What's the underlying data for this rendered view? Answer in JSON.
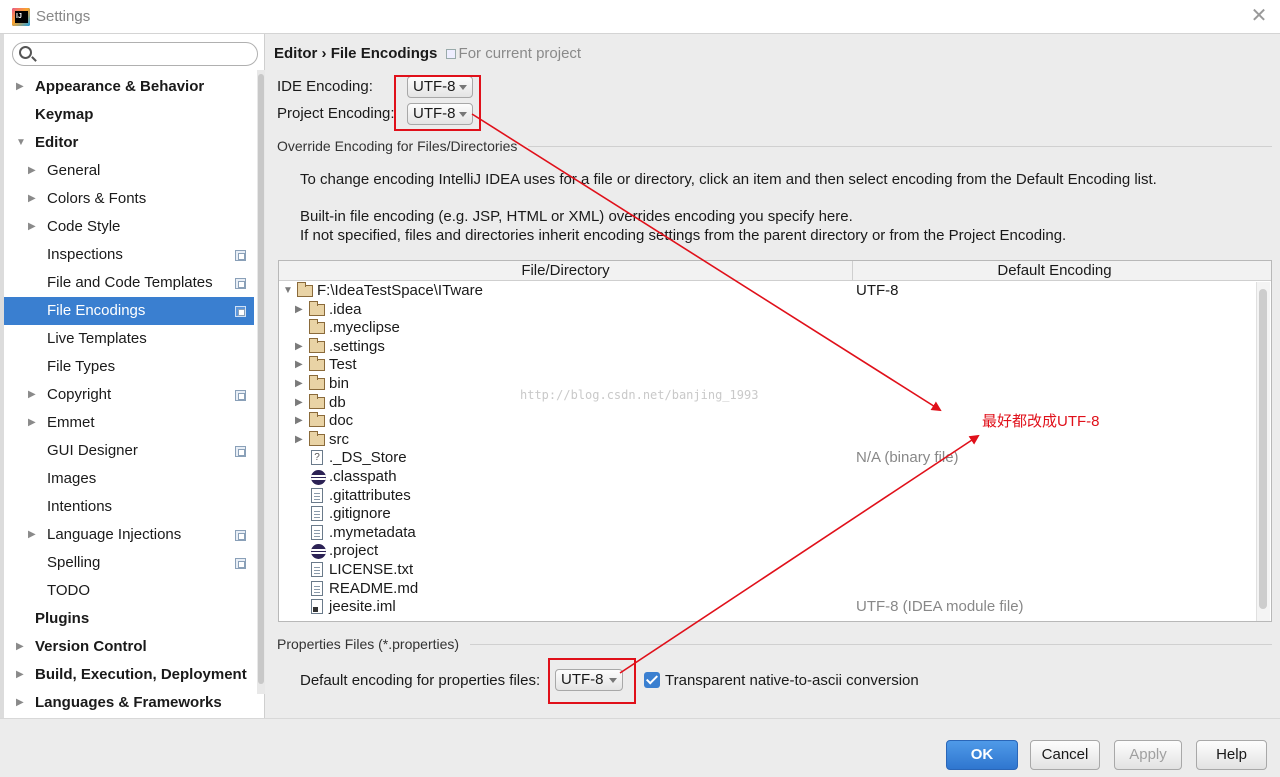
{
  "window": {
    "title": "Settings"
  },
  "search": {
    "placeholder": "",
    "value": ""
  },
  "sidebar": {
    "items": [
      {
        "label": "Appearance & Behavior",
        "bold": true,
        "arrow": "▶",
        "indent": 0
      },
      {
        "label": "Keymap",
        "bold": true,
        "arrow": "",
        "indent": 0
      },
      {
        "label": "Editor",
        "bold": true,
        "arrow": "▼",
        "indent": 0
      },
      {
        "label": "General",
        "bold": false,
        "arrow": "▶",
        "indent": 1
      },
      {
        "label": "Colors & Fonts",
        "bold": false,
        "arrow": "▶",
        "indent": 1
      },
      {
        "label": "Code Style",
        "bold": false,
        "arrow": "▶",
        "indent": 1
      },
      {
        "label": "Inspections",
        "bold": false,
        "arrow": "",
        "indent": 1,
        "project": true
      },
      {
        "label": "File and Code Templates",
        "bold": false,
        "arrow": "",
        "indent": 1,
        "project": true
      },
      {
        "label": "File Encodings",
        "bold": false,
        "arrow": "",
        "indent": 1,
        "project": true,
        "selected": true
      },
      {
        "label": "Live Templates",
        "bold": false,
        "arrow": "",
        "indent": 1
      },
      {
        "label": "File Types",
        "bold": false,
        "arrow": "",
        "indent": 1
      },
      {
        "label": "Copyright",
        "bold": false,
        "arrow": "▶",
        "indent": 1,
        "project": true
      },
      {
        "label": "Emmet",
        "bold": false,
        "arrow": "▶",
        "indent": 1
      },
      {
        "label": "GUI Designer",
        "bold": false,
        "arrow": "",
        "indent": 1,
        "project": true
      },
      {
        "label": "Images",
        "bold": false,
        "arrow": "",
        "indent": 1
      },
      {
        "label": "Intentions",
        "bold": false,
        "arrow": "",
        "indent": 1
      },
      {
        "label": "Language Injections",
        "bold": false,
        "arrow": "▶",
        "indent": 1,
        "project": true
      },
      {
        "label": "Spelling",
        "bold": false,
        "arrow": "",
        "indent": 1,
        "project": true
      },
      {
        "label": "TODO",
        "bold": false,
        "arrow": "",
        "indent": 1
      },
      {
        "label": "Plugins",
        "bold": true,
        "arrow": "",
        "indent": 0
      },
      {
        "label": "Version Control",
        "bold": true,
        "arrow": "▶",
        "indent": 0
      },
      {
        "label": "Build, Execution, Deployment",
        "bold": true,
        "arrow": "▶",
        "indent": 0
      },
      {
        "label": "Languages & Frameworks",
        "bold": true,
        "arrow": "▶",
        "indent": 0
      }
    ]
  },
  "main": {
    "breadcrumb": {
      "parent": "Editor",
      "separator": "›",
      "current": "File Encodings",
      "scope": "For current project"
    },
    "ide_encoding": {
      "label": "IDE Encoding:",
      "value": "UTF-8"
    },
    "project_encoding": {
      "label": "Project Encoding:",
      "value": "UTF-8"
    },
    "override_section": "Override Encoding for Files/Directories",
    "desc_line1": "To change encoding IntelliJ IDEA uses for a file or directory, click an item and then select encoding from the Default Encoding list.",
    "desc_line2": "Built-in file encoding (e.g. JSP, HTML or XML) overrides encoding you specify here.",
    "desc_line3": "If not specified, files and directories inherit encoding settings from the parent directory or from the Project Encoding.",
    "table": {
      "columns": [
        "File/Directory",
        "Default Encoding"
      ],
      "rows": [
        {
          "name": "F:\\IdeaTestSpace\\ITware",
          "encoding": "UTF-8",
          "icon": "folder",
          "arrow": "▼",
          "level": 0
        },
        {
          "name": ".idea",
          "encoding": "",
          "icon": "folder",
          "arrow": "▶",
          "level": 1
        },
        {
          "name": ".myeclipse",
          "encoding": "",
          "icon": "folder",
          "arrow": "",
          "level": 1
        },
        {
          "name": ".settings",
          "encoding": "",
          "icon": "folder",
          "arrow": "▶",
          "level": 1
        },
        {
          "name": "Test",
          "encoding": "",
          "icon": "folder",
          "arrow": "▶",
          "level": 1
        },
        {
          "name": "bin",
          "encoding": "",
          "icon": "folder",
          "arrow": "▶",
          "level": 1
        },
        {
          "name": "db",
          "encoding": "",
          "icon": "folder",
          "arrow": "▶",
          "level": 1
        },
        {
          "name": "doc",
          "encoding": "",
          "icon": "folder",
          "arrow": "▶",
          "level": 1
        },
        {
          "name": "src",
          "encoding": "",
          "icon": "folder",
          "arrow": "▶",
          "level": 1
        },
        {
          "name": "._DS_Store",
          "encoding": "N/A (binary file)",
          "icon": "unknown",
          "arrow": "",
          "level": 1
        },
        {
          "name": ".classpath",
          "encoding": "",
          "icon": "eclipse",
          "arrow": "",
          "level": 1
        },
        {
          "name": ".gitattributes",
          "encoding": "",
          "icon": "file",
          "arrow": "",
          "level": 1
        },
        {
          "name": ".gitignore",
          "encoding": "",
          "icon": "file",
          "arrow": "",
          "level": 1
        },
        {
          "name": ".mymetadata",
          "encoding": "",
          "icon": "file",
          "arrow": "",
          "level": 1
        },
        {
          "name": ".project",
          "encoding": "",
          "icon": "eclipse",
          "arrow": "",
          "level": 1
        },
        {
          "name": "LICENSE.txt",
          "encoding": "",
          "icon": "file",
          "arrow": "",
          "level": 1
        },
        {
          "name": "README.md",
          "encoding": "",
          "icon": "file",
          "arrow": "",
          "level": 1
        },
        {
          "name": "jeesite.iml",
          "encoding": "UTF-8 (IDEA module file)",
          "icon": "iml",
          "arrow": "",
          "level": 1
        }
      ]
    },
    "watermark": "http://blog.csdn.net/banjing_1993",
    "annotation": "最好都改成UTF-8",
    "properties_section": "Properties Files (*.properties)",
    "properties_label": "Default encoding for properties files:",
    "properties_value": "UTF-8",
    "native_ascii_label": "Transparent native-to-ascii conversion",
    "native_ascii_checked": true
  },
  "buttons": {
    "ok": "OK",
    "cancel": "Cancel",
    "apply": "Apply",
    "help": "Help"
  },
  "colors": {
    "accent": "#3a7fd0",
    "annotation_red": "#e0101a"
  }
}
